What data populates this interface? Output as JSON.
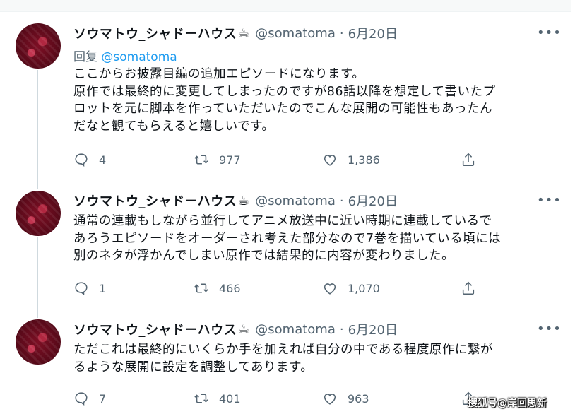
{
  "tweets": [
    {
      "name": "ソウマトウ_シャドーハウス",
      "emoji": "☕",
      "handle": "@somatoma",
      "dot": "·",
      "date": "6月20日",
      "reply_label": "回复",
      "reply_to": "@somatoma",
      "text": "ここからお披露目編の追加エピソードになります。\n原作では最終的に変更してしまったのですが86話以降を想定して書いたプ\nロットを元に脚本を作っていただいたのでこんな展開の可能性もあったん\nだなと観てもらえると嬉しいです。",
      "replies": "4",
      "retweets": "977",
      "likes": "1,386"
    },
    {
      "name": "ソウマトウ_シャドーハウス",
      "emoji": "☕",
      "handle": "@somatoma",
      "dot": "·",
      "date": "6月20日",
      "text": "通常の連載もしながら並行してアニメ放送中に近い時期に連載しているで\nあろうエピソードをオーダーされ考えた部分なので7巻を描いている頃には\n別のネタが浮かんでしまい原作では結果的に内容が変わりました。",
      "replies": "1",
      "retweets": "466",
      "likes": "1,070"
    },
    {
      "name": "ソウマトウ_シャドーハウス",
      "emoji": "☕",
      "handle": "@somatoma",
      "dot": "·",
      "date": "6月20日",
      "text": "ただこれは最終的にいくらか手を加えれば自分の中である程度原作に繋が\nるような展開に設定を調整してあります。",
      "replies": "7",
      "retweets": "401",
      "likes": "963"
    }
  ],
  "more_label": "•••",
  "watermark": "搜狐号@岸回思新",
  "icons": {
    "reply": "reply-icon",
    "retweet": "retweet-icon",
    "like": "heart-icon",
    "share": "share-icon"
  },
  "colors": {
    "link": "#1d9bf0",
    "muted": "#536471",
    "text": "#0f1419"
  }
}
